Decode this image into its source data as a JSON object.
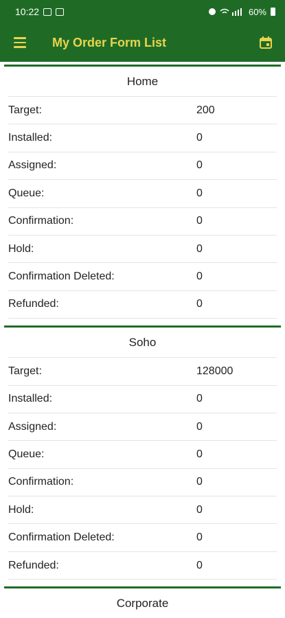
{
  "status_bar": {
    "time": "10:22",
    "battery": "60%"
  },
  "app_bar": {
    "title": "My Order Form List",
    "menu_icon": "menu-icon",
    "calendar_icon": "calendar-icon"
  },
  "colors": {
    "primary": "#1f6b26",
    "accent": "#e8d44d"
  },
  "sections": [
    {
      "title": "Home",
      "rows": [
        {
          "label": "Target:",
          "value": "200"
        },
        {
          "label": "Installed:",
          "value": "0"
        },
        {
          "label": "Assigned:",
          "value": "0"
        },
        {
          "label": "Queue:",
          "value": "0"
        },
        {
          "label": "Confirmation:",
          "value": "0"
        },
        {
          "label": "Hold:",
          "value": "0"
        },
        {
          "label": "Confirmation Deleted:",
          "value": "0"
        },
        {
          "label": "Refunded:",
          "value": "0"
        }
      ]
    },
    {
      "title": "Soho",
      "rows": [
        {
          "label": "Target:",
          "value": "128000"
        },
        {
          "label": "Installed:",
          "value": "0"
        },
        {
          "label": "Assigned:",
          "value": "0"
        },
        {
          "label": "Queue:",
          "value": "0"
        },
        {
          "label": "Confirmation:",
          "value": "0"
        },
        {
          "label": "Hold:",
          "value": "0"
        },
        {
          "label": "Confirmation Deleted:",
          "value": "0"
        },
        {
          "label": "Refunded:",
          "value": "0"
        }
      ]
    },
    {
      "title": "Corporate",
      "rows": []
    }
  ]
}
